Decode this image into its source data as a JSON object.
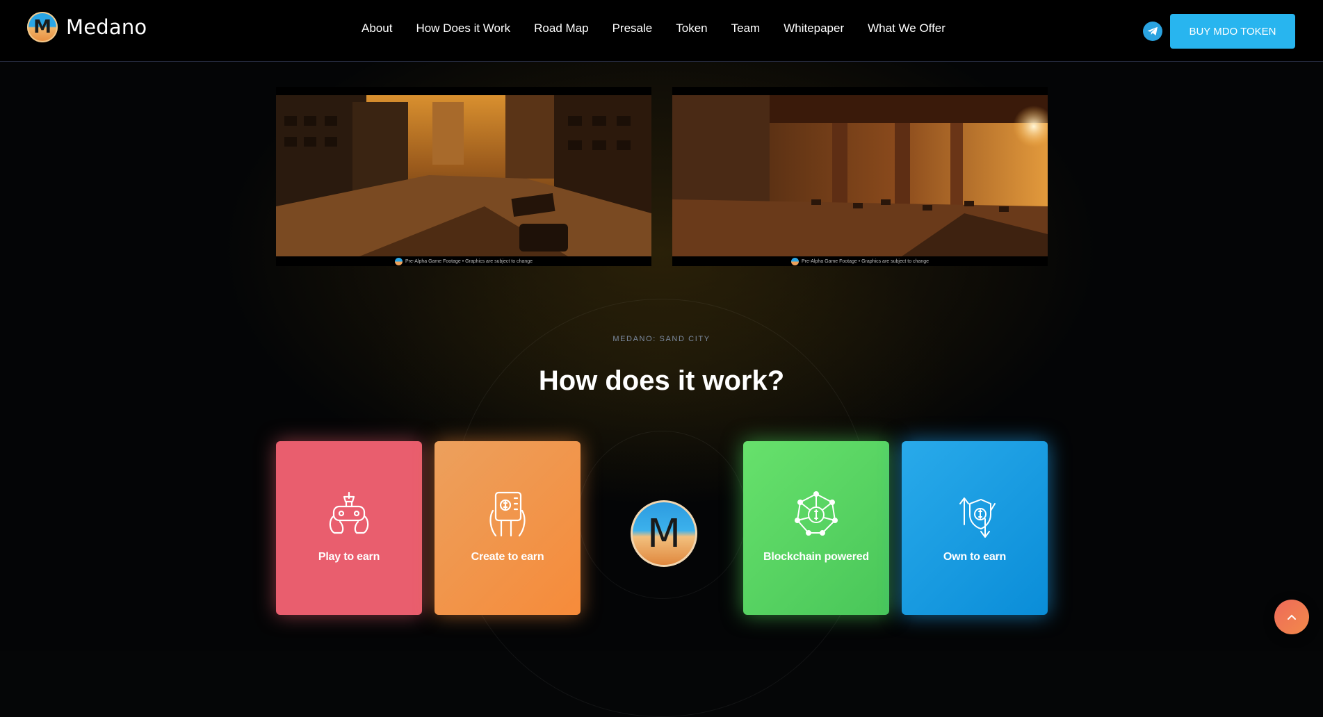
{
  "header": {
    "brand_name": "Medano",
    "brand_logo_letter": "M",
    "nav": [
      {
        "label": "About"
      },
      {
        "label": "How Does it Work"
      },
      {
        "label": "Road Map"
      },
      {
        "label": "Presale"
      },
      {
        "label": "Token"
      },
      {
        "label": "Team"
      },
      {
        "label": "Whitepaper"
      },
      {
        "label": "What We Offer"
      }
    ],
    "telegram_icon": "telegram-icon",
    "buy_button_label": "BUY MDO TOKEN",
    "colors": {
      "accent": "#28b5ef",
      "background": "#000000"
    }
  },
  "gallery": {
    "images": [
      {
        "caption": "Pre-Alpha Game Footage • Graphics are subject to change"
      },
      {
        "caption": "Pre-Alpha Game Footage • Graphics are subject to change"
      }
    ]
  },
  "section": {
    "eyebrow": "MEDANO: SAND CITY",
    "title": "How does it work?",
    "center_logo_letter": "M",
    "cards": [
      {
        "label": "Play to earn",
        "icon": "game-controller-icon",
        "color": "#e95e6e"
      },
      {
        "label": "Create to earn",
        "icon": "tablet-touch-icon",
        "color": "#f68b3a"
      },
      {
        "label": "Blockchain powered",
        "icon": "blockchain-network-icon",
        "color": "#4ec95a"
      },
      {
        "label": "Own to earn",
        "icon": "shield-transfer-icon",
        "color": "#1a9be2"
      }
    ]
  },
  "scroll_top_icon": "chevron-up-icon"
}
